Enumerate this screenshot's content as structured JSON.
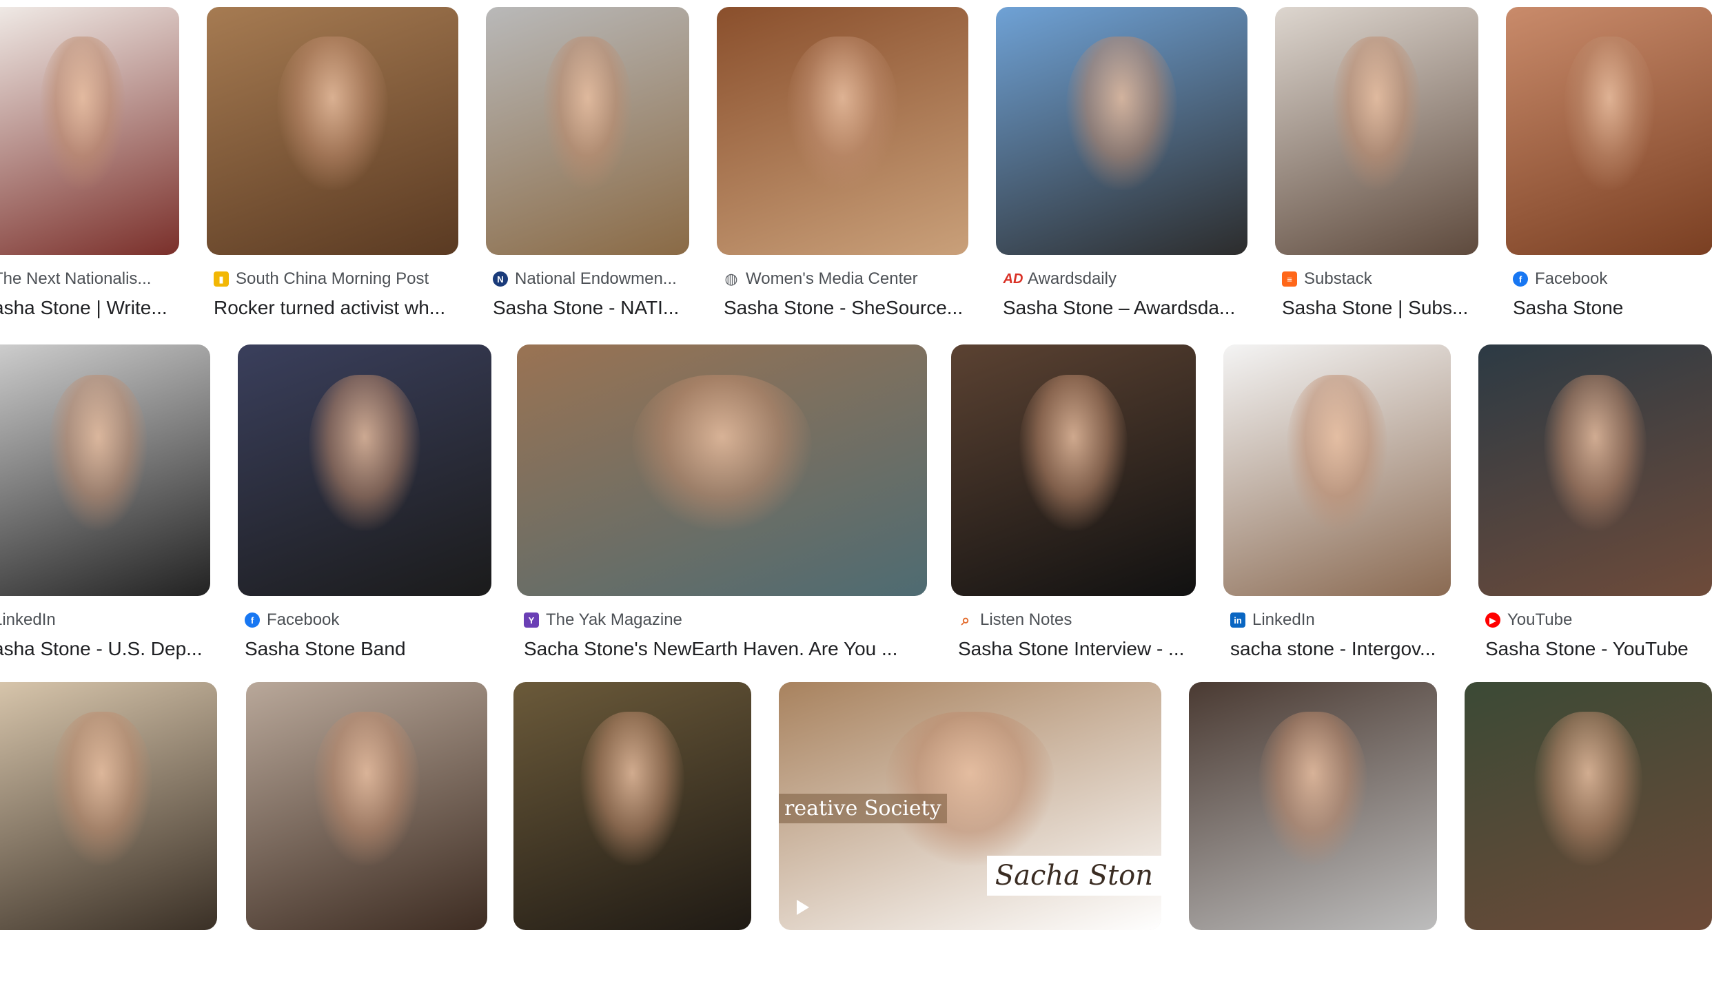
{
  "results": [
    {
      "source": "The Next Nationalis...",
      "title": "asha Stone | Write...",
      "favicon": "",
      "favicon_color": "#ffffff",
      "colors": [
        "#f1ece8",
        "#7a2f2a"
      ]
    },
    {
      "source": "South China Morning Post",
      "title": "Rocker turned activist wh...",
      "favicon": "scmp-icon",
      "favicon_color": "#f2b705",
      "colors": [
        "#a67b52",
        "#5a3a22"
      ]
    },
    {
      "source": "National Endowmen...",
      "title": "Sasha Stone - NATI...",
      "favicon": "ned-icon",
      "favicon_color": "#1a3b7a",
      "colors": [
        "#b9b9b9",
        "#8a6a45"
      ]
    },
    {
      "source": "Women's Media Center",
      "title": "Sasha Stone - SheSource...",
      "favicon": "globe-icon",
      "favicon_color": "#5f6368",
      "colors": [
        "#8a4f2c",
        "#c9a07a"
      ]
    },
    {
      "source": "Awardsdaily",
      "title": "Sasha Stone – Awardsda...",
      "favicon": "awardsdaily-icon",
      "favicon_color": "#d93025",
      "colors": [
        "#6fa2d6",
        "#2c2c2c"
      ]
    },
    {
      "source": "Substack",
      "title": "Sasha Stone | Subs...",
      "favicon": "substack-icon",
      "favicon_color": "#ff6719",
      "colors": [
        "#ddd6cf",
        "#5e4a3d"
      ]
    },
    {
      "source": "Facebook",
      "title": "Sasha Stone",
      "favicon": "facebook-icon",
      "favicon_color": "#1877f2",
      "colors": [
        "#c98b6b",
        "#7a3f22"
      ]
    },
    {
      "source": "LinkedIn",
      "title": "asha Stone - U.S. Dep...",
      "favicon": "",
      "favicon_color": "#ffffff",
      "colors": [
        "#cfcfcf",
        "#222222"
      ]
    },
    {
      "source": "Facebook",
      "title": "Sasha Stone Band",
      "favicon": "facebook-icon",
      "favicon_color": "#1877f2",
      "colors": [
        "#3a3f5c",
        "#1b1b1b"
      ]
    },
    {
      "source": "The Yak Magazine",
      "title": "Sacha Stone's NewEarth Haven. Are You ...",
      "favicon": "yak-icon",
      "favicon_color": "#6a3fb5",
      "colors": [
        "#9a7353",
        "#4e6b72"
      ]
    },
    {
      "source": "Listen Notes",
      "title": "Sasha Stone Interview - ...",
      "favicon": "search-icon",
      "favicon_color": "#e36b2c",
      "colors": [
        "#5b4232",
        "#111111"
      ]
    },
    {
      "source": "LinkedIn",
      "title": "sacha stone - Intergov...",
      "favicon": "linkedin-icon",
      "favicon_color": "#0a66c2",
      "colors": [
        "#f4f4f4",
        "#8a6a52"
      ]
    },
    {
      "source": "YouTube",
      "title": "Sasha Stone - YouTube",
      "favicon": "youtube-icon",
      "favicon_color": "#ff0000",
      "colors": [
        "#2c3a44",
        "#6e4b3a"
      ]
    },
    {
      "source": "",
      "title": "",
      "favicon": "",
      "favicon_color": "#ffffff",
      "colors": [
        "#d9c7ad",
        "#3a3026"
      ]
    },
    {
      "source": "",
      "title": "",
      "favicon": "",
      "favicon_color": "#ffffff",
      "colors": [
        "#b9a89a",
        "#3d2c22"
      ]
    },
    {
      "source": "",
      "title": "",
      "favicon": "",
      "favicon_color": "#ffffff",
      "colors": [
        "#6b5a3a",
        "#1f1a14"
      ]
    },
    {
      "source": "",
      "title": "",
      "favicon": "",
      "favicon_color": "#ffffff",
      "colors": [
        "#a8825e",
        "#ffffff"
      ],
      "overlay": "reative Society",
      "overlay2": "Sacha Ston"
    },
    {
      "source": "",
      "title": "",
      "favicon": "",
      "favicon_color": "#ffffff",
      "colors": [
        "#4a3a32",
        "#bdbdbd"
      ]
    },
    {
      "source": "",
      "title": "",
      "favicon": "",
      "favicon_color": "#ffffff",
      "colors": [
        "#3b4a36",
        "#6d4a38"
      ]
    }
  ],
  "favicon_glyphs": {
    "scmp-icon": "▮",
    "ned-icon": "N",
    "globe-icon": "◍",
    "awardsdaily-icon": "AD",
    "substack-icon": "≡",
    "facebook-icon": "f",
    "yak-icon": "Y",
    "search-icon": "⌕",
    "linkedin-icon": "in",
    "youtube-icon": "▶"
  }
}
